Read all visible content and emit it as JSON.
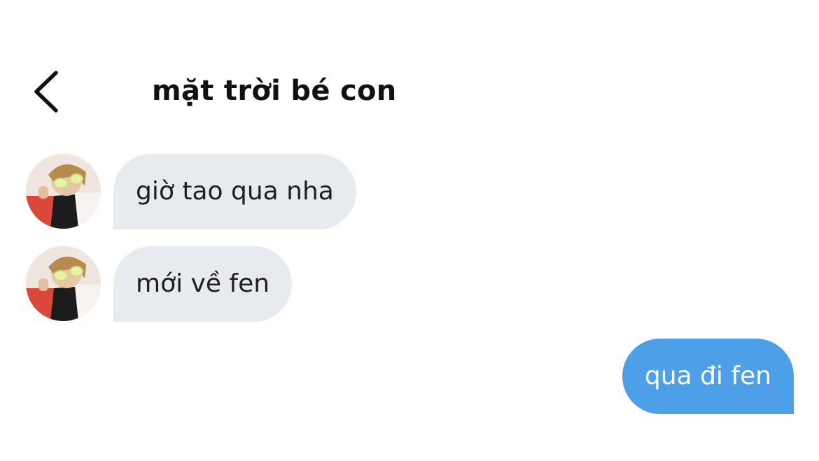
{
  "header": {
    "title": "mặt trời bé con",
    "back_icon": "chevron-left-icon"
  },
  "messages": [
    {
      "direction": "incoming",
      "text": "giờ tao qua nha",
      "avatar_icon": "contact-avatar"
    },
    {
      "direction": "incoming",
      "text": "mới về fen",
      "avatar_icon": "contact-avatar"
    },
    {
      "direction": "outgoing",
      "text": "qua đi fen"
    }
  ],
  "colors": {
    "incoming_bubble": "#e7ebef",
    "outgoing_bubble": "#4d9fe8",
    "title_text": "#111111",
    "incoming_text": "#1f1f1f",
    "outgoing_text": "#ffffff"
  }
}
